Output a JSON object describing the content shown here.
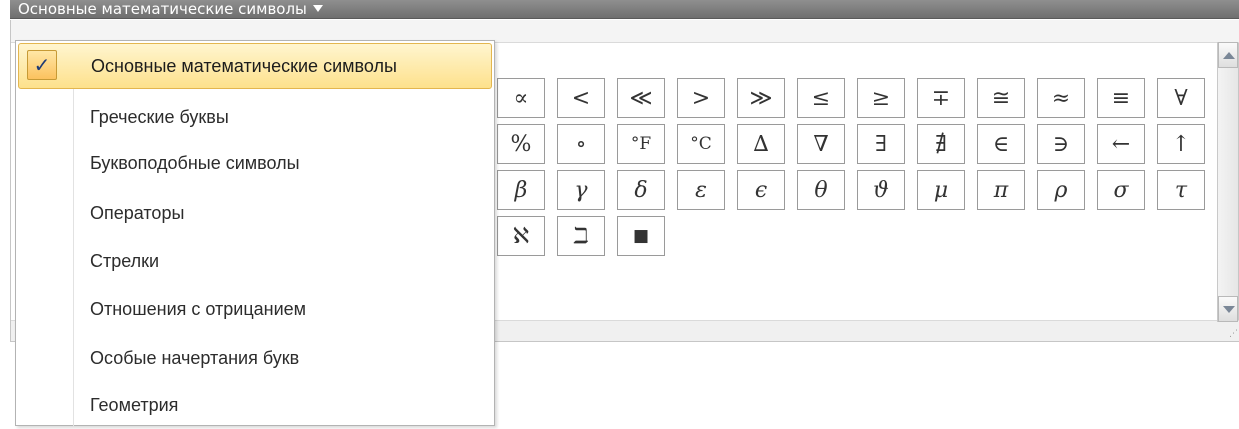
{
  "header": {
    "title": "Основные математические символы"
  },
  "menu": {
    "check_mark": "✓",
    "items": [
      {
        "label": "Основные математические символы",
        "selected": true
      },
      {
        "label": "Греческие буквы",
        "selected": false
      },
      {
        "label": "Буквоподобные символы",
        "selected": false
      },
      {
        "label": "Операторы",
        "selected": false
      },
      {
        "label": "Стрелки",
        "selected": false
      },
      {
        "label": "Отношения с отрицанием",
        "selected": false
      },
      {
        "label": "Особые начертания букв",
        "selected": false
      },
      {
        "label": "Геометрия",
        "selected": false
      }
    ]
  },
  "symbols": {
    "row1": [
      "∝",
      "<",
      "≪",
      ">",
      "≫",
      "≤",
      "≥",
      "∓",
      "≅",
      "≈",
      "≡",
      "∀"
    ],
    "row2": [
      "%",
      "∘",
      "°F",
      "°C",
      "∆",
      "∇",
      "∃",
      "∄",
      "∈",
      "∋",
      "←",
      "↑"
    ],
    "row3": [
      "β",
      "γ",
      "δ",
      "ε",
      "ϵ",
      "θ",
      "ϑ",
      "μ",
      "π",
      "ρ",
      "σ",
      "τ"
    ],
    "row4": [
      "ℵ",
      "ℶ",
      "■"
    ]
  },
  "colors": {
    "header_bg": "#7f7f7f",
    "selected_bg": "#fde18c",
    "selected_border": "#e3b64f",
    "check_color": "#1f3a75"
  }
}
